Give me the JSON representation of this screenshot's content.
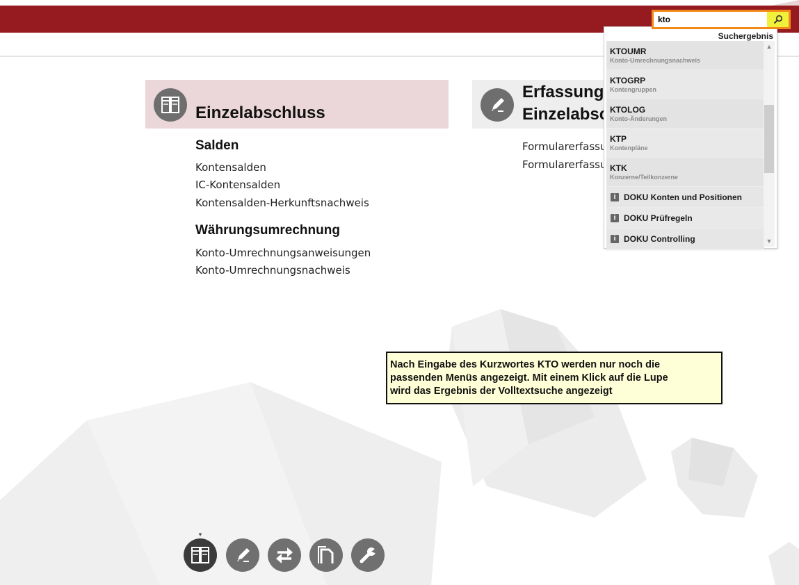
{
  "search": {
    "value": "kto",
    "results_label": "Suchergebnis",
    "results": [
      {
        "code": "KTOUMR",
        "description": "Konto-Umrechnungsnachweis"
      },
      {
        "code": "KTOGRP",
        "description": "Kontengruppen"
      },
      {
        "code": "KTOLOG",
        "description": "Konto-Änderungen"
      },
      {
        "code": "KTP",
        "description": "Kontenpläne"
      },
      {
        "code": "KTK",
        "description": "Konzerne/Teilkonzerne"
      }
    ],
    "docs": [
      {
        "label": "DOKU Konten und Positionen"
      },
      {
        "label": "DOKU Prüfregeln"
      },
      {
        "label": "DOKU Controlling"
      }
    ]
  },
  "tiles": [
    {
      "title": "Einzelabschluss",
      "sections": [
        {
          "title": "Salden",
          "links": [
            "Kontensalden",
            "IC-Kontensalden",
            "Kontensalden-Herkunftsnachweis"
          ]
        },
        {
          "title": "Währungsumrechnung",
          "links": [
            "Konto-Umrechnungsanweisungen",
            "Konto-Umrechnungsnachweis"
          ]
        }
      ]
    },
    {
      "title_line1": "Erfassung",
      "title_line2": "Einzelabsc",
      "links": [
        "Formularerfassur",
        "Formularerfassur"
      ]
    }
  ],
  "tooltip": {
    "line1": "Nach Eingabe des Kurzwortes KTO werden nur noch die",
    "line2": "passenden Menüs angezeigt. Mit einem Klick auf die Lupe",
    "line3": "wird das Ergebnis der Volltextsuche angezeigt"
  },
  "bottom_nav": {
    "marker": "▼",
    "items": [
      {
        "icon": "table-icon",
        "active": true
      },
      {
        "icon": "pencil-icon",
        "active": false
      },
      {
        "icon": "exchange-icon",
        "active": false
      },
      {
        "icon": "document-icon",
        "active": false
      },
      {
        "icon": "wrench-icon",
        "active": false
      }
    ]
  },
  "colors": {
    "topbar": "#951b20",
    "search_border": "#f28a1a",
    "search_button": "#f1f13c",
    "tile_active": "#ebd6d9",
    "tile_inactive": "#eeeeee",
    "tooltip_bg": "#ffffd7"
  }
}
